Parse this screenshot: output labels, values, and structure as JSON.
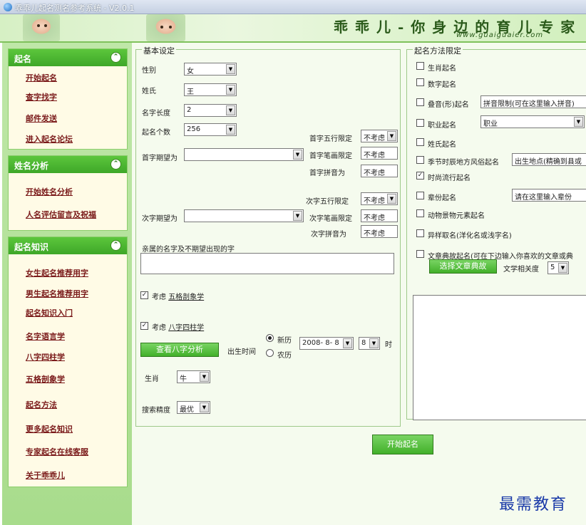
{
  "window": {
    "title": "乖乖儿起名测名参考系统 - V2.0.1"
  },
  "banner": {
    "slogan": "乖乖儿-你身边的育儿专家",
    "url": "www.guaiguaier.com"
  },
  "sidebar": {
    "panels": [
      {
        "title": "起名",
        "collapse_icon": "chevron-up-double",
        "items": [
          "开始起名",
          "查字找字",
          "邮件发送",
          "进入起名论坛"
        ]
      },
      {
        "title": "姓名分析",
        "collapse_icon": "chevron-up-double",
        "items": [
          "开始姓名分析",
          "人名评估留言及祝福"
        ]
      },
      {
        "title": "起名知识",
        "collapse_icon": "chevron-up-double",
        "items": [
          "女生起名推荐用字",
          "男生起名推荐用字",
          "起名知识入门",
          "名字语言学",
          "八字四柱学",
          "五格剖象学",
          "起名方法",
          "更多起名知识",
          "专家起名在线客服",
          "关于乖乖儿"
        ]
      }
    ]
  },
  "basic": {
    "legend": "基本设定",
    "gender_label": "性别",
    "gender_value": "女",
    "surname_label": "姓氏",
    "surname_value": "王",
    "length_label": "名字长度",
    "length_value": "2",
    "count_label": "起名个数",
    "count_value": "256",
    "first_wuxing_label": "首字五行限定",
    "first_wuxing_value": "不考虑",
    "first_expect_label": "首字期望为",
    "first_expect_value": "",
    "first_stroke_label": "首字笔画限定",
    "first_stroke_value": "不考虑",
    "first_pinyin_label": "首字拼音为",
    "first_pinyin_value": "不考虑",
    "second_wuxing_label": "次字五行限定",
    "second_wuxing_value": "不考虑",
    "second_expect_label": "次字期望为",
    "second_expect_value": "",
    "second_stroke_label": "次字笔画限定",
    "second_stroke_value": "不考虑",
    "second_pinyin_label": "次字拼音为",
    "second_pinyin_value": "不考虑",
    "relatives_label": "亲属的名字及不期望出现的字",
    "relatives_value": "",
    "wuge_prefix": "考虑",
    "wuge_link": "五格剖象学",
    "wuge_checked": true,
    "bazi_prefix": "考虑",
    "bazi_link": "八字四柱学",
    "bazi_checked": true,
    "bazi_button": "查看八字分析",
    "birth_label": "出生时间",
    "cal_solar": "新历",
    "cal_lunar": "农历",
    "birth_date": "2008- 8- 8",
    "birth_hour": "8",
    "hour_unit": "时",
    "zodiac_label": "生肖",
    "zodiac_value": "牛",
    "precision_label": "搜索精度",
    "precision_value": "最优"
  },
  "methods": {
    "legend": "起名方法限定",
    "items": [
      {
        "label": "生肖起名",
        "checked": false
      },
      {
        "label": "数字起名",
        "checked": false
      },
      {
        "label": "叠音(形)起名",
        "checked": false,
        "input": "拼音限制(可在这里输入拼音)"
      },
      {
        "label": "职业起名",
        "checked": false,
        "select": "职业"
      },
      {
        "label": "姓氏起名",
        "checked": false
      },
      {
        "label": "季节时辰地方风俗起名",
        "checked": false,
        "input": "出生地点(精确到县或"
      },
      {
        "label": "时尚流行起名",
        "checked": true
      },
      {
        "label": "辈份起名",
        "checked": false,
        "input": "请在这里输入辈份"
      },
      {
        "label": "动物景物元素起名",
        "checked": false
      },
      {
        "label": "异样取名(洋化名或浅字名)",
        "checked": false
      },
      {
        "label": "文章典故起名(可在下边输入你喜欢的文章或典",
        "checked": false
      }
    ],
    "choose_button": "选择文章典故",
    "relevance_label": "文学相关度",
    "relevance_value": "5",
    "article_text": ""
  },
  "actions": {
    "start_button": "开始起名"
  },
  "watermark": "最需教育",
  "colors": {
    "accent": "#42b02a",
    "sidebar_bg": "#bfe7a8",
    "link": "#7a1a1a"
  }
}
